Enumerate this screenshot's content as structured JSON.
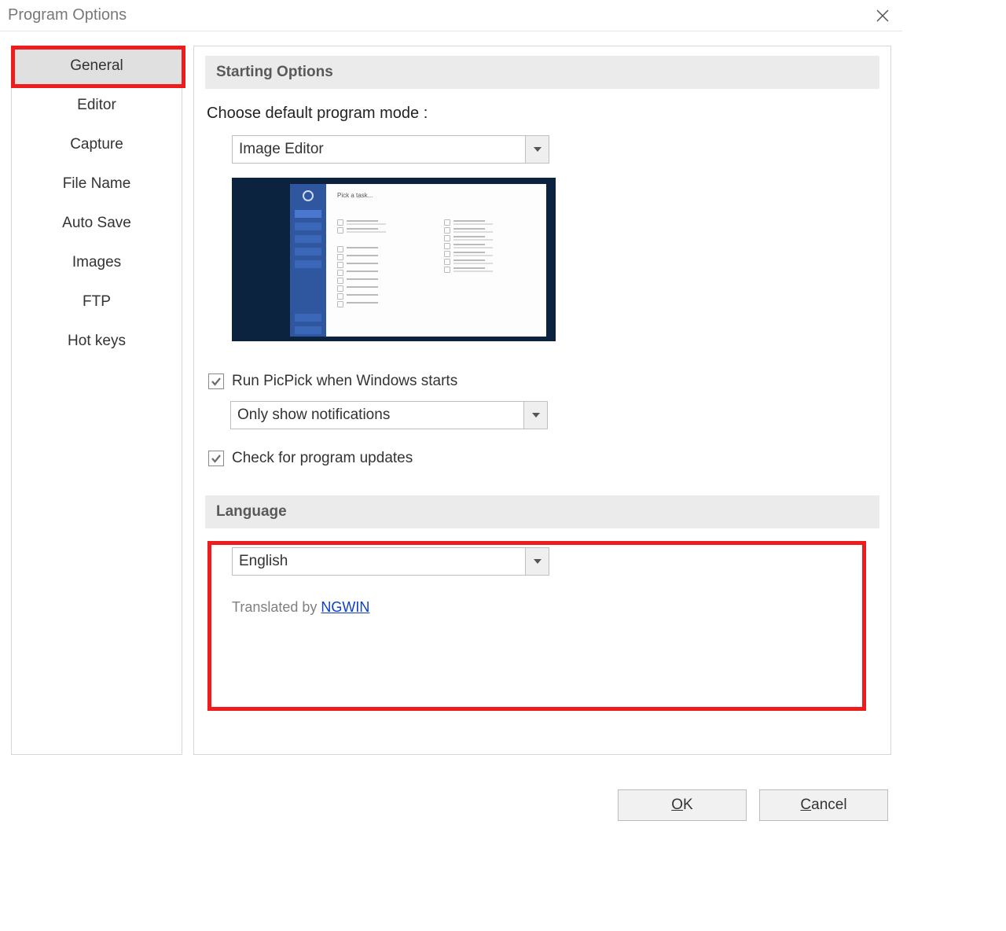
{
  "window": {
    "title": "Program Options"
  },
  "sidebar": {
    "items": [
      {
        "label": "General",
        "active": true
      },
      {
        "label": "Editor"
      },
      {
        "label": "Capture"
      },
      {
        "label": "File Name"
      },
      {
        "label": "Auto Save"
      },
      {
        "label": "Images"
      },
      {
        "label": "FTP"
      },
      {
        "label": "Hot keys"
      }
    ]
  },
  "sections": {
    "starting": {
      "header": "Starting Options",
      "choose_label": "Choose default program mode :",
      "mode_value": "Image Editor",
      "preview_title": "Pick a task...",
      "run_on_start_label": "Run PicPick when Windows starts",
      "tray_value": "Only show notifications",
      "check_updates_label": "Check for program updates"
    },
    "language": {
      "header": "Language",
      "value": "English",
      "translated_prefix": "Translated by ",
      "translator": "NGWIN"
    }
  },
  "footer": {
    "ok": "OK",
    "cancel": "Cancel"
  }
}
